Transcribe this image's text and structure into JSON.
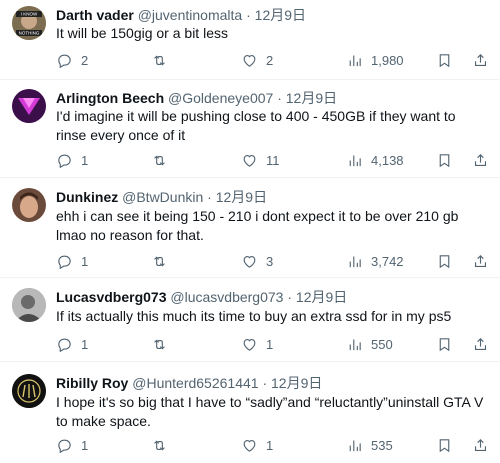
{
  "tweets": [
    {
      "name": "Darth vader",
      "handle": "@juventinomalta",
      "dot": "·",
      "date": "12月9日",
      "text": "It will be 150gig or a bit less",
      "replies": "2",
      "retweets": "",
      "likes": "2",
      "views": "1,980",
      "avatar_text": "I KNOW",
      "avatar_text2": "NOTHING",
      "avatar_color": "#8a7a5a"
    },
    {
      "name": "Arlington Beech",
      "handle": "@Goldeneye007",
      "dot": "·",
      "date": "12月9日",
      "text": "I'd imagine it will be pushing close to 400 - 450GB if they want to rinse every once of it",
      "replies": "1",
      "retweets": "",
      "likes": "11",
      "views": "4,138",
      "avatar_color": "#8b2f9e"
    },
    {
      "name": "Dunkinez",
      "handle": "@BtwDunkin",
      "dot": "·",
      "date": "12月9日",
      "text": "ehh i can see it being 150 - 210 i dont expect it to be over 210 gb lmao no reason for that.",
      "replies": "1",
      "retweets": "",
      "likes": "3",
      "views": "3,742",
      "avatar_color": "#c9a38a"
    },
    {
      "name": "Lucasvdberg073",
      "handle": "@lucasvdberg073",
      "dot": "·",
      "date": "12月9日",
      "text": "If its actually this much its time to buy an extra ssd for in my ps5",
      "replies": "1",
      "retweets": "",
      "likes": "1",
      "views": "550",
      "avatar_color": "#9a9a9a"
    },
    {
      "name": "Ribilly Roy",
      "handle": "@Hunterd65261441",
      "dot": "·",
      "date": "12月9日",
      "text": "I hope it's so big that I have to “sadly”and “reluctantly”uninstall GTA V to make space.",
      "replies": "1",
      "retweets": "",
      "likes": "1",
      "views": "535",
      "avatar_color": "#111111"
    }
  ]
}
